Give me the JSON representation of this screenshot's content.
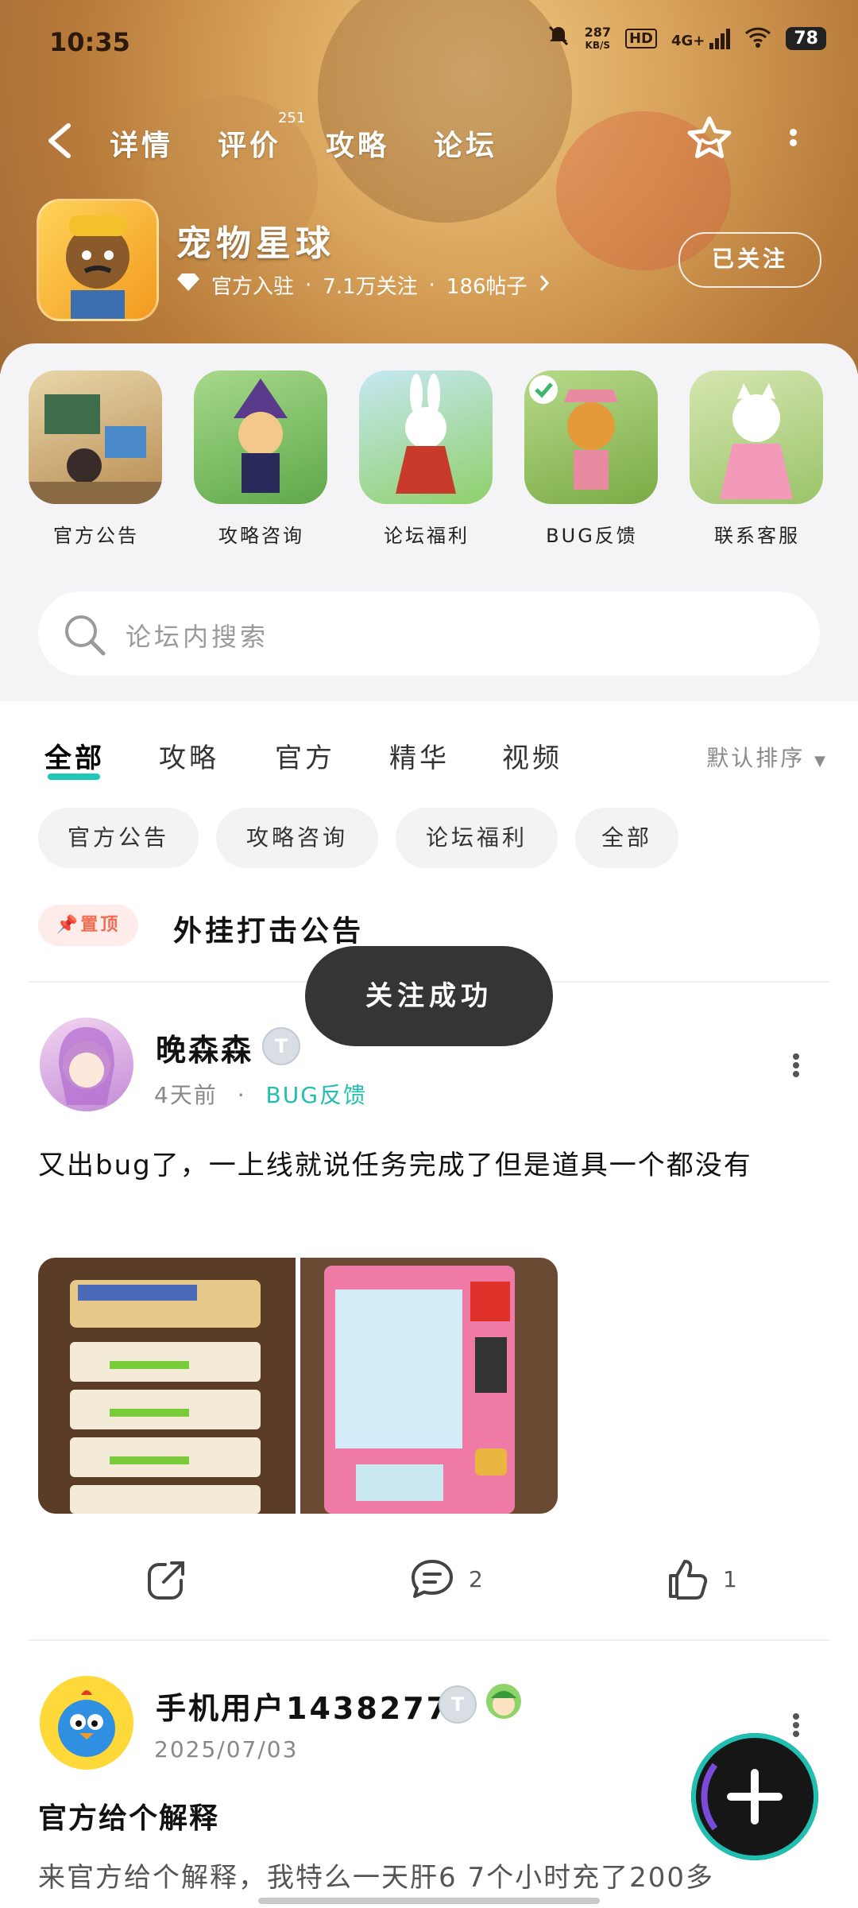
{
  "status_bar": {
    "time": "10:35",
    "net_speed_top": "287",
    "net_speed_bottom": "KB/S",
    "hd": "HD",
    "signal": "4G+",
    "battery": "78"
  },
  "nav": {
    "tabs": [
      "详情",
      "评价",
      "攻略",
      "论坛"
    ],
    "review_count": "251",
    "active_tab": "论坛"
  },
  "game": {
    "title": "宠物星球",
    "official": "官方入驻",
    "followers": "7.1万关注",
    "posts": "186帖子",
    "follow_label": "已关注"
  },
  "categories": [
    {
      "label": "官方公告",
      "color": "#c9a871"
    },
    {
      "label": "攻略咨询",
      "color": "#7fbf6a"
    },
    {
      "label": "论坛福利",
      "color": "#8cc7d8"
    },
    {
      "label": "BUG反馈",
      "color": "#8fb85a"
    },
    {
      "label": "联系客服",
      "color": "#b6d48c"
    }
  ],
  "search": {
    "placeholder": "论坛内搜索"
  },
  "filter_tabs": [
    "全部",
    "攻略",
    "官方",
    "精华",
    "视频"
  ],
  "sort_label": "默认排序",
  "chips": [
    "官方公告",
    "攻略咨询",
    "论坛福利",
    "全部"
  ],
  "pinned": {
    "badge": "置顶",
    "title": "外挂打击公告"
  },
  "toast": "关注成功",
  "post1": {
    "user": "晚森森",
    "level": "T",
    "time": "4天前",
    "tag": "BUG反馈",
    "text": "又出bug了，一上线就说任务完成了但是道具一个都没有",
    "comments": "2",
    "likes": "1"
  },
  "post2": {
    "user": "手机用户14382770",
    "level": "T",
    "date": "2025/07/03",
    "title": "官方给个解释",
    "text": "来官方给个解释，我特么一天肝6 7个小时充了200多"
  },
  "colors": {
    "accent": "#1fc7b8",
    "pin": "#f26b50"
  }
}
